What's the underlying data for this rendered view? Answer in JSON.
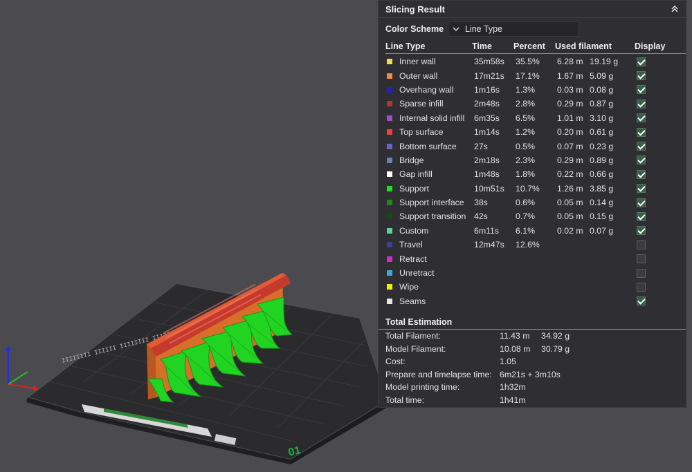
{
  "panel": {
    "title": "Slicing Result",
    "color_scheme_label": "Color Scheme",
    "color_scheme_value": "Line Type",
    "columns": {
      "line_type": "Line Type",
      "time": "Time",
      "percent": "Percent",
      "used_filament": "Used filament",
      "display": "Display"
    },
    "rows": [
      {
        "name": "Inner wall",
        "color": "#f2d94e",
        "time": "35m58s",
        "percent": "35.5%",
        "length": "6.28 m",
        "weight": "19.19 g",
        "display": true
      },
      {
        "name": "Outer wall",
        "color": "#f08a3c",
        "time": "17m21s",
        "percent": "17.1%",
        "length": "1.67 m",
        "weight": "5.09 g",
        "display": true
      },
      {
        "name": "Overhang wall",
        "color": "#1f1fdc",
        "time": "1m16s",
        "percent": "1.3%",
        "length": "0.03 m",
        "weight": "0.08 g",
        "display": true
      },
      {
        "name": "Sparse infill",
        "color": "#b03434",
        "time": "2m48s",
        "percent": "2.8%",
        "length": "0.29 m",
        "weight": "0.87 g",
        "display": true
      },
      {
        "name": "Internal solid infill",
        "color": "#9a4fc4",
        "time": "6m35s",
        "percent": "6.5%",
        "length": "1.01 m",
        "weight": "3.10 g",
        "display": true
      },
      {
        "name": "Top surface",
        "color": "#f04040",
        "time": "1m14s",
        "percent": "1.2%",
        "length": "0.20 m",
        "weight": "0.61 g",
        "display": true
      },
      {
        "name": "Bottom surface",
        "color": "#6b62c8",
        "time": "27s",
        "percent": "0.5%",
        "length": "0.07 m",
        "weight": "0.23 g",
        "display": true
      },
      {
        "name": "Bridge",
        "color": "#5f86b5",
        "time": "2m18s",
        "percent": "2.3%",
        "length": "0.29 m",
        "weight": "0.89 g",
        "display": true
      },
      {
        "name": "Gap infill",
        "color": "#ffffff",
        "time": "1m48s",
        "percent": "1.8%",
        "length": "0.22 m",
        "weight": "0.66 g",
        "display": true
      },
      {
        "name": "Support",
        "color": "#1fe01f",
        "time": "10m51s",
        "percent": "10.7%",
        "length": "1.26 m",
        "weight": "3.85 g",
        "display": true
      },
      {
        "name": "Support interface",
        "color": "#1b8a1b",
        "time": "38s",
        "percent": "0.6%",
        "length": "0.05 m",
        "weight": "0.14 g",
        "display": true
      },
      {
        "name": "Support transition",
        "color": "#0f4d0f",
        "time": "42s",
        "percent": "0.7%",
        "length": "0.05 m",
        "weight": "0.15 g",
        "display": true
      },
      {
        "name": "Custom",
        "color": "#5ecf9a",
        "time": "6m11s",
        "percent": "6.1%",
        "length": "0.02 m",
        "weight": "0.07 g",
        "display": true
      },
      {
        "name": "Travel",
        "color": "#33479a",
        "time": "12m47s",
        "percent": "12.6%",
        "length": "",
        "weight": "",
        "display": false
      },
      {
        "name": "Retract",
        "color": "#d42ad4",
        "time": "",
        "percent": "",
        "length": "",
        "weight": "",
        "display": false
      },
      {
        "name": "Unretract",
        "color": "#3fa7d6",
        "time": "",
        "percent": "",
        "length": "",
        "weight": "",
        "display": false
      },
      {
        "name": "Wipe",
        "color": "#f0f000",
        "time": "",
        "percent": "",
        "length": "",
        "weight": "",
        "display": false
      },
      {
        "name": "Seams",
        "color": "#e6e6e6",
        "time": "",
        "percent": "",
        "length": "",
        "weight": "",
        "display": true
      }
    ],
    "total": {
      "title": "Total Estimation",
      "rows": [
        {
          "label": "Total Filament:",
          "v1": "11.43 m",
          "v2": "34.92 g"
        },
        {
          "label": "Model Filament:",
          "v1": "10.08 m",
          "v2": "30.79 g"
        },
        {
          "label": "Cost:",
          "v1": "1.05",
          "v2": ""
        },
        {
          "label": "Prepare and timelapse time:",
          "v1": "6m21s + 3m10s",
          "v2": ""
        },
        {
          "label": "Model printing time:",
          "v1": "1h32m",
          "v2": ""
        },
        {
          "label": "Total time:",
          "v1": "1h41m",
          "v2": ""
        }
      ]
    }
  },
  "scene": {
    "plate_label": "01",
    "colors": {
      "background": "#4a4a4f",
      "plate": "#2b2b2e",
      "outer_wall": "#e0782f",
      "top_surface": "#c63a2e",
      "support": "#22d422"
    }
  }
}
